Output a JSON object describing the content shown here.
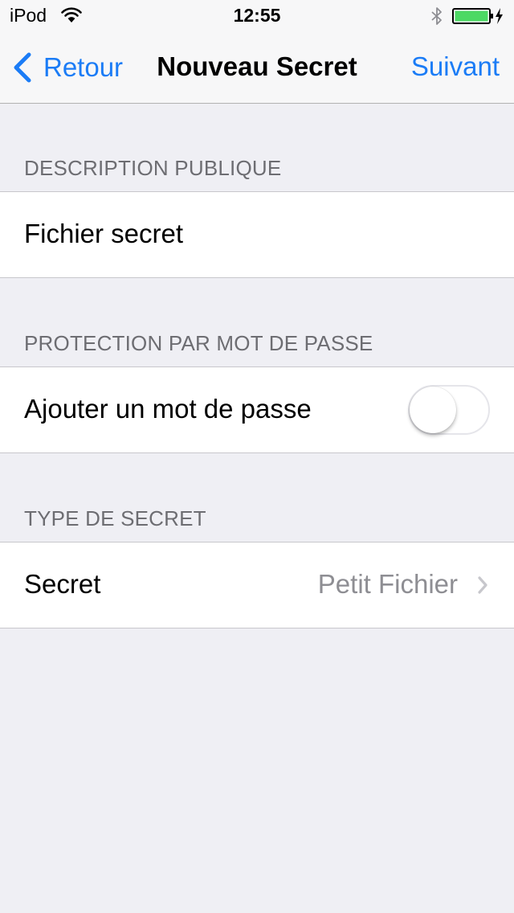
{
  "status_bar": {
    "carrier": "iPod",
    "time": "12:55",
    "icons": [
      "wifi-icon",
      "bluetooth-icon",
      "battery-icon",
      "charging-bolt-icon"
    ],
    "battery_color": "#4cd964"
  },
  "nav": {
    "back_label": "Retour",
    "title": "Nouveau Secret",
    "next_label": "Suivant",
    "accent_color": "#1b7cf6"
  },
  "sections": {
    "description": {
      "header": "DESCRIPTION PUBLIQUE",
      "value": "Fichier secret"
    },
    "protection": {
      "header": "PROTECTION PAR MOT DE PASSE",
      "toggle_label": "Ajouter un mot de passe",
      "toggle_on": false
    },
    "type": {
      "header": "TYPE DE SECRET",
      "label": "Secret",
      "value": "Petit Fichier"
    }
  }
}
